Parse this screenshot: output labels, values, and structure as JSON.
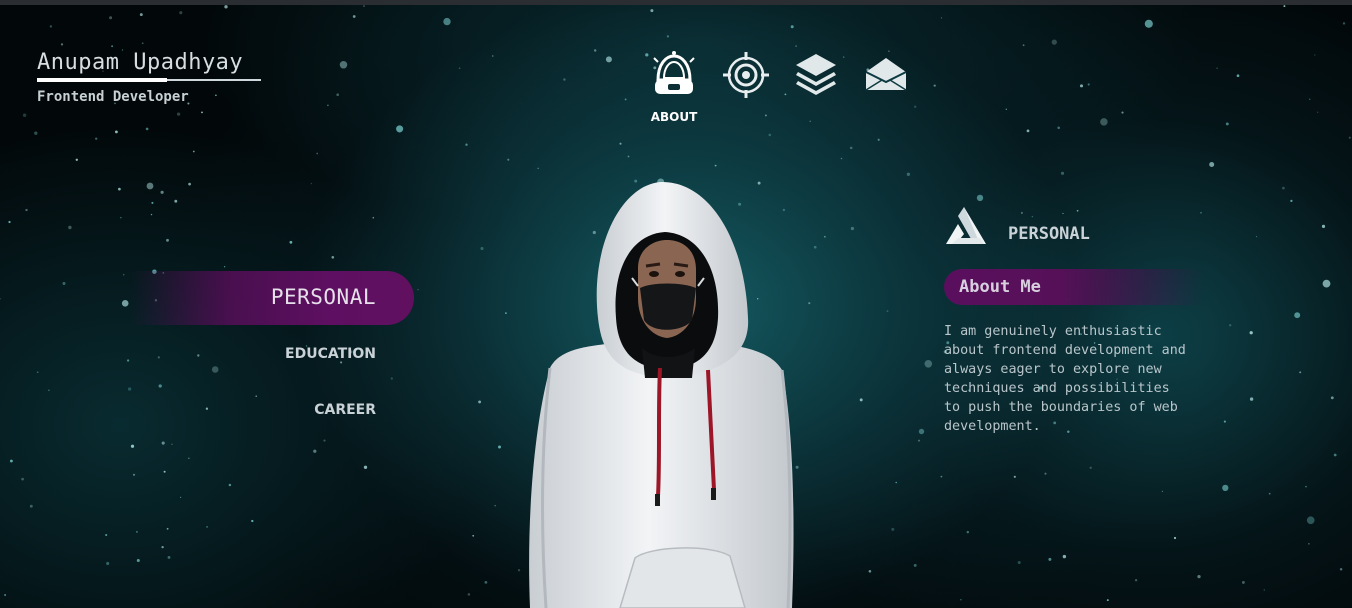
{
  "brand": {
    "name": "Anupam Upadhyay",
    "role": "Frontend Developer"
  },
  "nav": {
    "items": [
      {
        "icon": "astronaut-helmet-icon",
        "label": "ABOUT",
        "active": true
      },
      {
        "icon": "target-icon",
        "label": "",
        "active": false
      },
      {
        "icon": "layers-icon",
        "label": "",
        "active": false
      },
      {
        "icon": "envelope-icon",
        "label": "",
        "active": false
      }
    ]
  },
  "side_menu": {
    "active": "PERSONAL",
    "items": [
      "EDUCATION",
      "CAREER"
    ],
    "accent": "#5e0f61"
  },
  "panel": {
    "icon": "penrose-triangle-icon",
    "title": "PERSONAL",
    "subtitle": "About Me",
    "text": "I am genuinely enthusiastic\nabout frontend development and\nalways eager to explore new\ntechniques and possibilities\nto push the boundaries of web\ndevelopment."
  },
  "colors": {
    "background": "#02080a",
    "teal_glow": "#166068",
    "accent_purple": "#5e0f61",
    "text": "#cfd8dc"
  }
}
